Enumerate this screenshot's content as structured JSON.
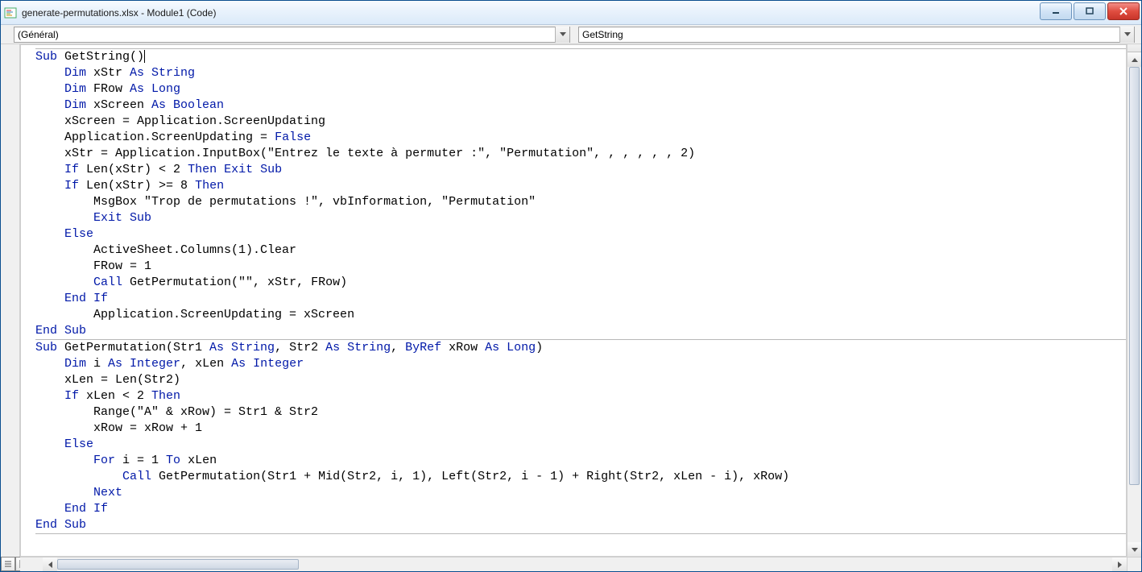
{
  "window": {
    "title": "generate-permutations.xlsx - Module1 (Code)"
  },
  "dropdowns": {
    "left": "(Général)",
    "right": "GetString"
  },
  "code": {
    "sub1": {
      "line1_kw1": "Sub",
      "line1_rest": " GetString()",
      "line2_kw1": "Dim",
      "line2_mid": " xStr ",
      "line2_kw2": "As String",
      "line3_kw1": "Dim",
      "line3_mid": " FRow ",
      "line3_kw2": "As Long",
      "line4_kw1": "Dim",
      "line4_mid": " xScreen ",
      "line4_kw2": "As Boolean",
      "line5": "    xScreen = Application.ScreenUpdating",
      "line6_pre": "    Application.ScreenUpdating = ",
      "line6_kw": "False",
      "line7": "    xStr = Application.InputBox(\"Entrez le texte à permuter :\", \"Permutation\", , , , , , 2)",
      "line8_kw1": "If",
      "line8_mid": " Len(xStr) < 2 ",
      "line8_kw2": "Then Exit Sub",
      "line9_kw1": "If",
      "line9_mid": " Len(xStr) >= 8 ",
      "line9_kw2": "Then",
      "line10": "        MsgBox \"Trop de permutations !\", vbInformation, \"Permutation\"",
      "line11_kw": "Exit Sub",
      "line12_kw": "Else",
      "line13": "        ActiveSheet.Columns(1).Clear",
      "line14": "        FRow = 1",
      "line15_kw": "Call",
      "line15_rest": " GetPermutation(\"\", xStr, FRow)",
      "line16_kw": "End If",
      "line17": "        Application.ScreenUpdating = xScreen",
      "line18_kw": "End Sub"
    },
    "sub2": {
      "line1_kw1": "Sub",
      "line1_mid1": " GetPermutation(Str1 ",
      "line1_kw2": "As String",
      "line1_mid2": ", Str2 ",
      "line1_kw3": "As String",
      "line1_mid3": ", ",
      "line1_kw4": "ByRef",
      "line1_mid4": " xRow ",
      "line1_kw5": "As Long",
      "line1_end": ")",
      "line2_kw1": "Dim",
      "line2_mid1": " i ",
      "line2_kw2": "As Integer",
      "line2_mid2": ", xLen ",
      "line2_kw3": "As Integer",
      "line3": "    xLen = Len(Str2)",
      "line4_kw1": "If",
      "line4_mid": " xLen < 2 ",
      "line4_kw2": "Then",
      "line5": "        Range(\"A\" & xRow) = Str1 & Str2",
      "line6": "        xRow = xRow + 1",
      "line7_kw": "Else",
      "line8_kw1": "For",
      "line8_mid1": " i = 1 ",
      "line8_kw2": "To",
      "line8_mid2": " xLen",
      "line9_kw": "Call",
      "line9_rest": " GetPermutation(Str1 + Mid(Str2, i, 1), Left(Str2, i - 1) + Right(Str2, xLen - i), xRow)",
      "line10_kw": "Next",
      "line11_kw": "End If",
      "line12_kw": "End Sub"
    }
  }
}
